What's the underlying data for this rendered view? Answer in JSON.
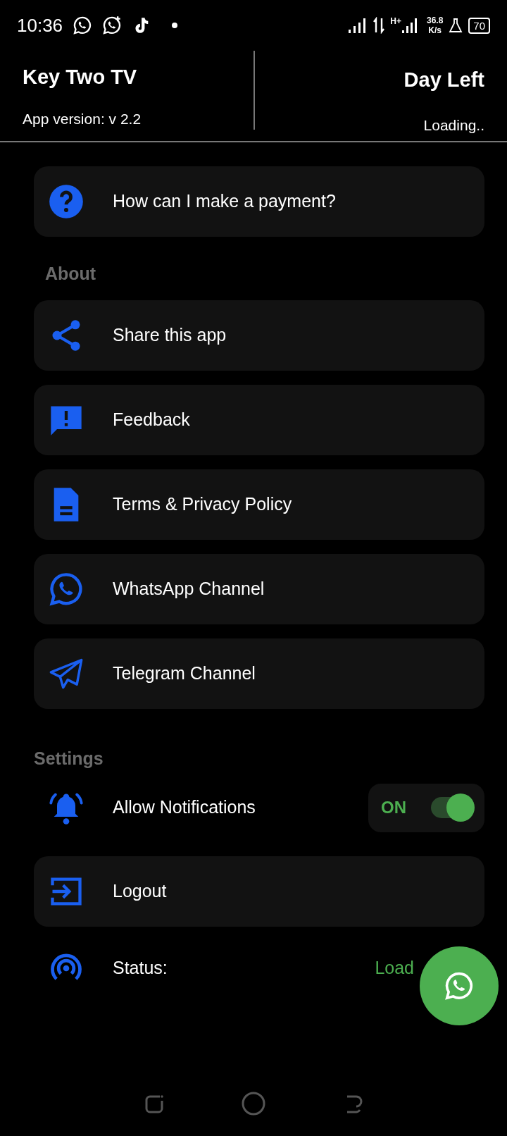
{
  "status_bar": {
    "time": "10:36",
    "network_type": "H+",
    "speed": "36.8",
    "speed_unit": "K/s",
    "battery": "70"
  },
  "header": {
    "title": "Key Two TV",
    "version": "App version: v 2.2",
    "right_title": "Day Left",
    "right_value": "Loading.."
  },
  "faq": {
    "label": "How can I make a payment?"
  },
  "about": {
    "title": "About",
    "items": [
      {
        "label": "Share this app"
      },
      {
        "label": "Feedback"
      },
      {
        "label": "Terms & Privacy Policy"
      },
      {
        "label": "WhatsApp Channel"
      },
      {
        "label": "Telegram Channel"
      }
    ]
  },
  "settings": {
    "title": "Settings",
    "items": [
      {
        "kind": "toggle",
        "label": "Allow Notifications",
        "toggle_label": "ON",
        "on": true
      },
      {
        "kind": "link",
        "label": "Logout"
      },
      {
        "kind": "status",
        "label": "Status:",
        "value": "Load"
      }
    ]
  }
}
